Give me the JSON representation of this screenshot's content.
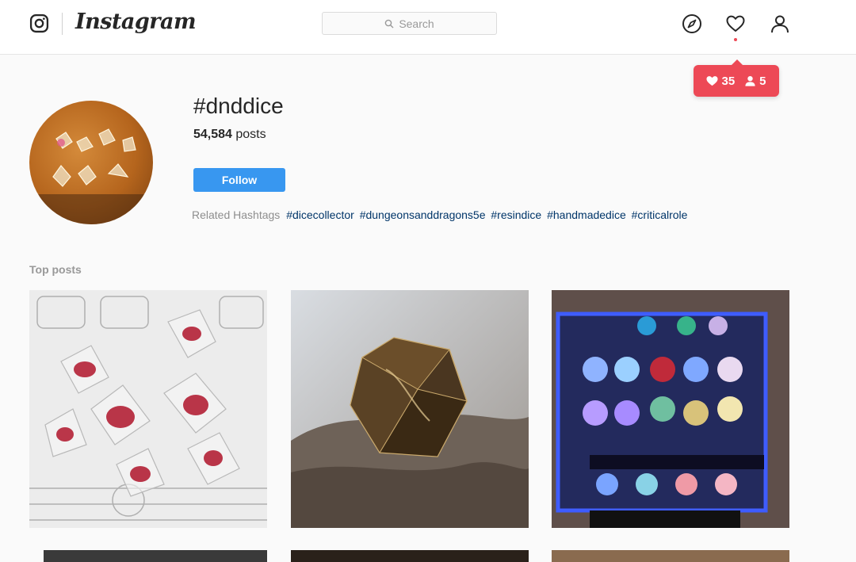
{
  "header": {
    "brand": "Instagram",
    "search_placeholder": "Search",
    "icons": [
      "instagram-glyph-icon",
      "search-icon",
      "compass-icon",
      "heart-icon",
      "person-icon"
    ]
  },
  "notifications": {
    "likes": "35",
    "follows": "5"
  },
  "hashtag": {
    "title": "#dnddice",
    "post_count": "54,584",
    "post_suffix": " posts",
    "follow_label": "Follow",
    "related_label": "Related Hashtags",
    "related": [
      "#dicecollector",
      "#dungeonsanddragons5e",
      "#resindice",
      "#handmadedice",
      "#criticalrole"
    ]
  },
  "sections": {
    "top_posts": "Top posts"
  },
  "colors": {
    "follow_button": "#3897f0",
    "notification": "#ed4956",
    "hashtag_link": "#003569"
  }
}
